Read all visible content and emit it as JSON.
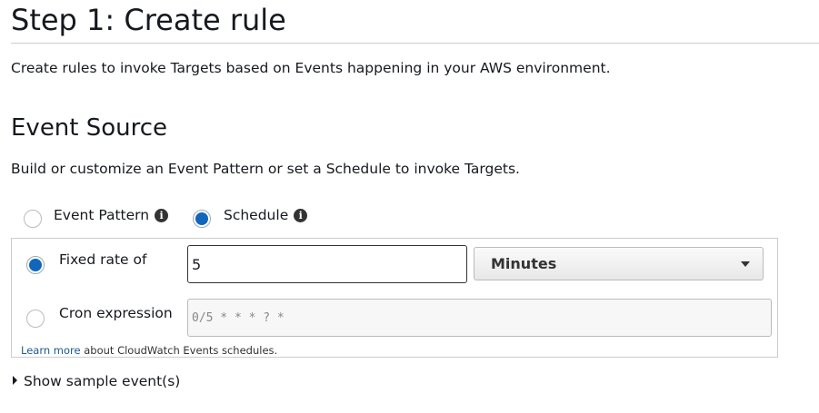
{
  "title": "Step 1: Create rule",
  "description": "Create rules to invoke Targets based on Events happening in your AWS environment.",
  "event_source": {
    "heading": "Event Source",
    "subtext": "Build or customize an Event Pattern or set a Schedule to invoke Targets.",
    "options": [
      {
        "label": "Event Pattern",
        "selected": false
      },
      {
        "label": "Schedule",
        "selected": true
      }
    ],
    "info_glyph": "i"
  },
  "schedule": {
    "fixed_rate_label": "Fixed rate of",
    "fixed_rate_value": "5",
    "unit_selected": "Minutes",
    "cron_label": "Cron expression",
    "cron_placeholder": "0/5 * * * ? *",
    "learn_more_link": "Learn more",
    "learn_more_text": " about CloudWatch Events schedules.",
    "mode": "fixed_rate"
  },
  "show_sample": "Show sample event(s)",
  "colors": {
    "accent": "#1166bb",
    "link": "#1a5a96"
  }
}
